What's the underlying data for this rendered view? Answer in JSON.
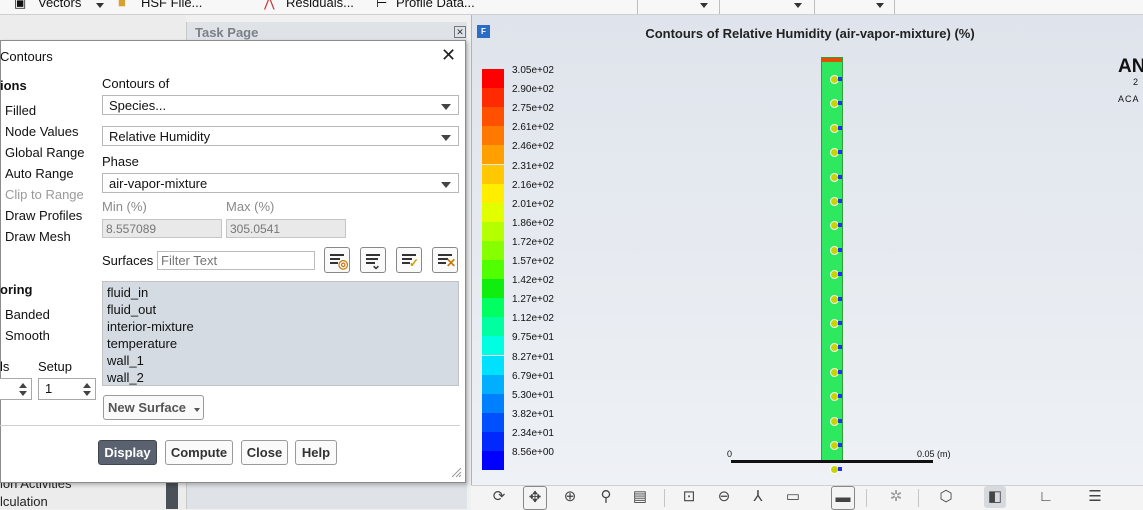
{
  "toolbar": {
    "items": [
      "Vectors",
      "HSF File...",
      "Residuals...",
      "Profile Data..."
    ]
  },
  "task_page": {
    "title": "Task Page",
    "bottom_items": [
      "ion Activities",
      "lculation"
    ]
  },
  "dialog": {
    "title": "Contours",
    "options_title": "ions",
    "options": [
      {
        "label": "Filled",
        "enabled": true
      },
      {
        "label": "Node Values",
        "enabled": true
      },
      {
        "label": "Global Range",
        "enabled": true
      },
      {
        "label": "Auto Range",
        "enabled": true
      },
      {
        "label": "Clip to Range",
        "enabled": false
      },
      {
        "label": "Draw Profiles",
        "enabled": true
      },
      {
        "label": "Draw Mesh",
        "enabled": true
      }
    ],
    "coloring_title": "oring",
    "coloring": [
      "Banded",
      "Smooth"
    ],
    "levels_label": "ls",
    "setup_label": "Setup",
    "setup_value": "1",
    "contours_of_label": "Contours of",
    "contours_of_value": "Species...",
    "variable_value": "Relative Humidity",
    "phase_label": "Phase",
    "phase_value": "air-vapor-mixture",
    "min_label": "Min (%)",
    "max_label": "Max (%)",
    "min_value": "8.557089",
    "max_value": "305.0541",
    "surfaces_label": "Surfaces",
    "filter_placeholder": "Filter Text",
    "surfaces": [
      "fluid_in",
      "fluid_out",
      "interior-mixture",
      "temperature",
      "wall_1",
      "wall_2"
    ],
    "new_surface_label": "New Surface",
    "buttons": {
      "display": "Display",
      "compute": "Compute",
      "close": "Close",
      "help": "Help"
    }
  },
  "graphics": {
    "title": "Contours of Relative Humidity (air-vapor-mixture)  (%)",
    "logo_text": "AN",
    "logo_sub1": "2",
    "logo_sub2": "ACA",
    "legend": [
      {
        "label": "3.05e+02",
        "color": "#ff0000"
      },
      {
        "label": "2.90e+02",
        "color": "#ff2a00"
      },
      {
        "label": "2.75e+02",
        "color": "#ff5000"
      },
      {
        "label": "2.61e+02",
        "color": "#ff7800"
      },
      {
        "label": "2.46e+02",
        "color": "#ffa000"
      },
      {
        "label": "2.31e+02",
        "color": "#ffc800"
      },
      {
        "label": "2.16e+02",
        "color": "#ffee00"
      },
      {
        "label": "2.01e+02",
        "color": "#e2ff00"
      },
      {
        "label": "1.86e+02",
        "color": "#b4ff00"
      },
      {
        "label": "1.72e+02",
        "color": "#86ff00"
      },
      {
        "label": "1.57e+02",
        "color": "#50ff00"
      },
      {
        "label": "1.42e+02",
        "color": "#10ee10"
      },
      {
        "label": "1.27e+02",
        "color": "#00ff60"
      },
      {
        "label": "1.12e+02",
        "color": "#00ffa0"
      },
      {
        "label": "9.75e+01",
        "color": "#00ffe0"
      },
      {
        "label": "8.27e+01",
        "color": "#00e0ff"
      },
      {
        "label": "6.79e+01",
        "color": "#00b0ff"
      },
      {
        "label": "5.30e+01",
        "color": "#0080ff"
      },
      {
        "label": "3.82e+01",
        "color": "#0050ff"
      },
      {
        "label": "2.34e+01",
        "color": "#0028ff"
      },
      {
        "label": "8.56e+00",
        "color": "#0000ff"
      }
    ],
    "scale_start": "0",
    "scale_end": "0.05 (m)"
  }
}
